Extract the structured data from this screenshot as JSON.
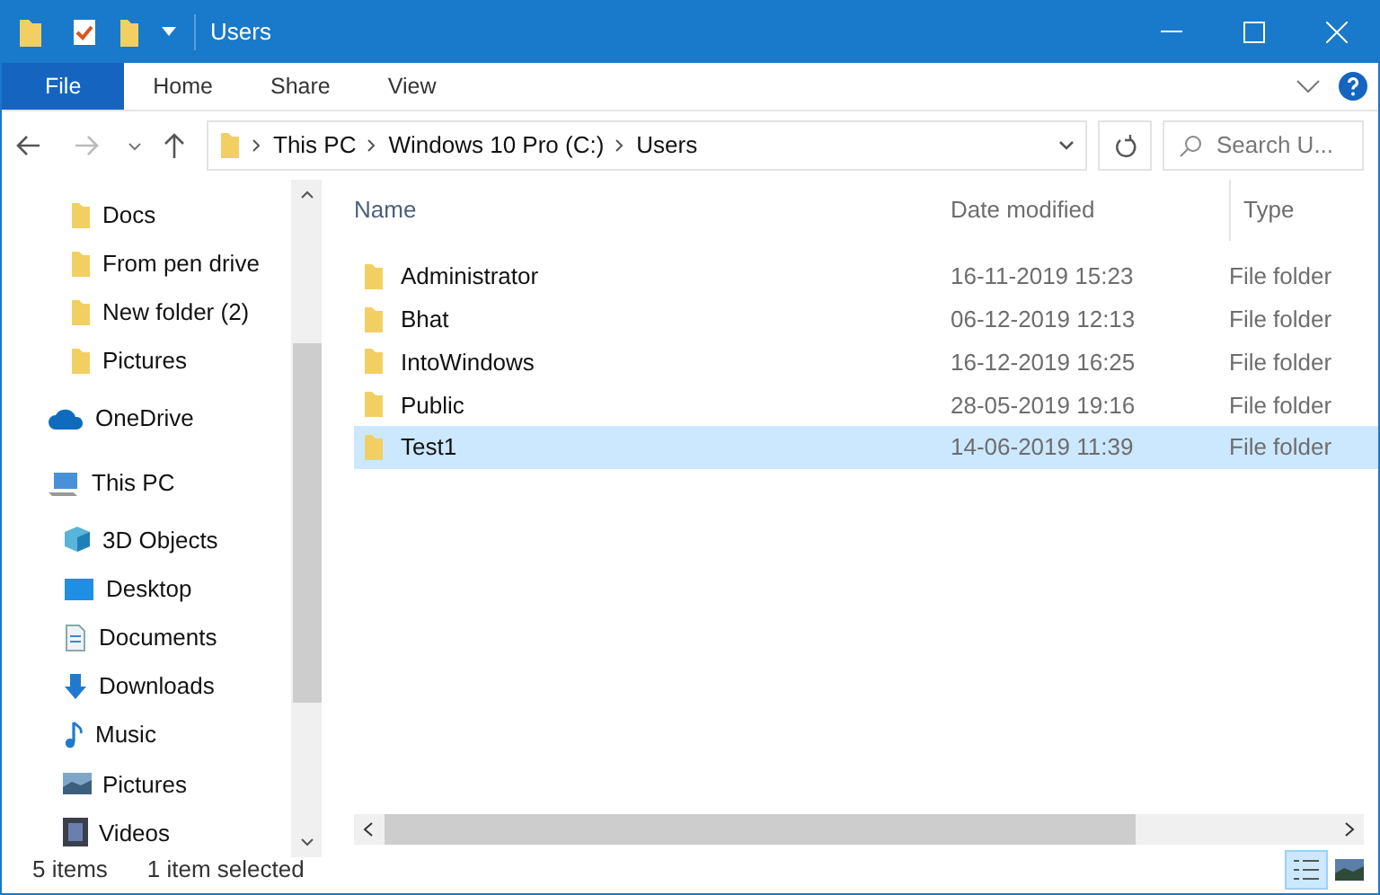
{
  "window": {
    "title": "Users"
  },
  "ribbon_tabs": [
    {
      "label": "File",
      "selected": true
    },
    {
      "label": "Home",
      "selected": false
    },
    {
      "label": "Share",
      "selected": false
    },
    {
      "label": "View",
      "selected": false
    }
  ],
  "address": {
    "path": [
      "This PC",
      "Windows 10 Pro (C:)",
      "Users"
    ]
  },
  "search": {
    "placeholder": "Search U..."
  },
  "sidebar": {
    "items": [
      {
        "label": "Docs",
        "kind": "folder"
      },
      {
        "label": "From pen drive",
        "kind": "folder"
      },
      {
        "label": "New folder (2)",
        "kind": "folder"
      },
      {
        "label": "Pictures",
        "kind": "folder"
      },
      {
        "label": "OneDrive",
        "kind": "cloud"
      },
      {
        "label": "This PC",
        "kind": "pc",
        "children": [
          {
            "label": "3D Objects",
            "kind": "cube"
          },
          {
            "label": "Desktop",
            "kind": "desktop"
          },
          {
            "label": "Documents",
            "kind": "document"
          },
          {
            "label": "Downloads",
            "kind": "download"
          },
          {
            "label": "Music",
            "kind": "music"
          },
          {
            "label": "Pictures",
            "kind": "image"
          },
          {
            "label": "Videos",
            "kind": "video"
          }
        ]
      }
    ]
  },
  "table": {
    "columns": [
      "Name",
      "Date modified",
      "Type"
    ],
    "rows": [
      {
        "name": "Administrator",
        "date": "16-11-2019 15:23",
        "type": "File folder",
        "selected": false
      },
      {
        "name": "Bhat",
        "date": "06-12-2019 12:13",
        "type": "File folder",
        "selected": false
      },
      {
        "name": "IntoWindows",
        "date": "16-12-2019 16:25",
        "type": "File folder",
        "selected": false
      },
      {
        "name": "Public",
        "date": "28-05-2019 19:16",
        "type": "File folder",
        "selected": false
      },
      {
        "name": "Test1",
        "date": "14-06-2019 11:39",
        "type": "File folder",
        "selected": true
      }
    ]
  },
  "status_bar": {
    "count": "5 items",
    "selection": "1 item selected"
  }
}
